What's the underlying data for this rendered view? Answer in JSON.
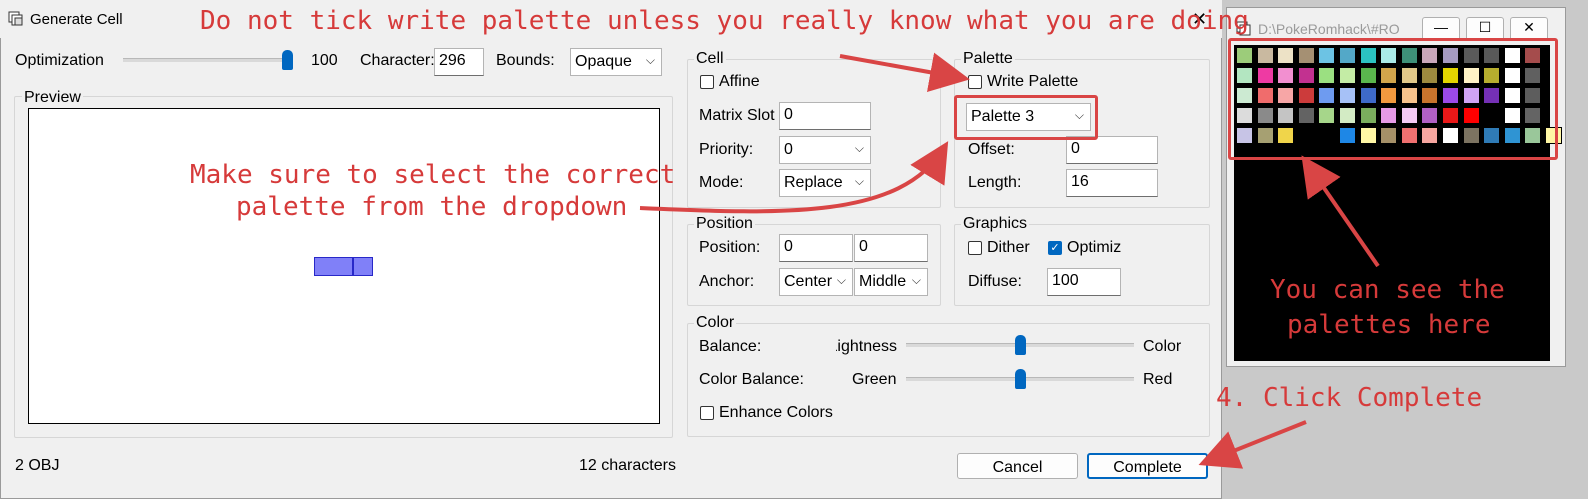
{
  "dialog": {
    "title": "Generate Cell",
    "close_glyph": "✕",
    "optimization_label": "Optimization",
    "optimization_value": "100",
    "optimization_level": 1.0,
    "character_label": "Character:",
    "character_value": "296",
    "bounds_label": "Bounds:",
    "bounds_value": "Opaque",
    "preview_label": "Preview",
    "cell": {
      "group_label": "Cell",
      "affine_label": "Affine",
      "affine_checked": false,
      "matrix_slot_label": "Matrix Slot",
      "matrix_slot_value": "0",
      "priority_label": "Priority:",
      "priority_value": "0",
      "mode_label": "Mode:",
      "mode_value": "Replace"
    },
    "palette": {
      "group_label": "Palette",
      "write_palette_label": "Write Palette",
      "write_palette_checked": false,
      "palette_select_value": "Palette 3",
      "offset_label": "Offset:",
      "offset_value": "0",
      "length_label": "Length:",
      "length_value": "16"
    },
    "position": {
      "group_label": "Position",
      "position_label": "Position:",
      "position_x": "0",
      "position_y": "0",
      "anchor_label": "Anchor:",
      "anchor_h": "Center",
      "anchor_v": "Middle"
    },
    "graphics": {
      "group_label": "Graphics",
      "dither_label": "Dither",
      "dither_checked": false,
      "optimize_label": "Optimize",
      "optimize_checked": true,
      "diffuse_label": "Diffuse:",
      "diffuse_value": "100"
    },
    "color": {
      "group_label": "Color",
      "balance_label": "Balance:",
      "balance_left": "Lightness",
      "balance_right": "Color",
      "balance_level": 0.5,
      "color_balance_label": "Color Balance:",
      "cb_left": "Green",
      "cb_right": "Red",
      "cb_level": 0.5,
      "enhance_label": "Enhance Colors",
      "enhance_checked": false
    },
    "status_left": "2 OBJ",
    "status_mid": "12 characters",
    "cancel_label": "Cancel",
    "complete_label": "Complete"
  },
  "palette_window": {
    "title": "D:\\PokeRomhack\\#RO",
    "minimize_glyph": "—",
    "maximize_glyph": "☐",
    "close_glyph": "✕",
    "rows": [
      [
        "#9ccc7a",
        "#c9b9a0",
        "#ede2c6",
        "#a59073",
        "#6cc3e4",
        "#53a8c8",
        "#2bc3c1",
        "#aaeae7",
        "#3e9078",
        "#c9a7ba",
        "#a59ac1",
        "#5a5a5a",
        "#595959",
        "#ffffff",
        "#a54c4c"
      ],
      [
        "#b3e6c1",
        "#ee3aa3",
        "#f28fd0",
        "#c23190",
        "#9be081",
        "#c4eca5",
        "#5ab64d",
        "#d2a54b",
        "#e1c889",
        "#9d8a3f",
        "#e3d400",
        "#fff3c6",
        "#b7ae2e",
        "#ffffff",
        "#606060"
      ],
      [
        "#ccead2",
        "#f06c6c",
        "#f7a6a6",
        "#cc3b3b",
        "#6e9bf0",
        "#a6c1f7",
        "#3e6ac8",
        "#f2993f",
        "#f7c28c",
        "#c8742d",
        "#9b4ae8",
        "#d0a4f4",
        "#7530b5",
        "#ffffff",
        "#5d5d5d"
      ],
      [
        "#dcdcdc",
        "#8a8a8a",
        "#c4c4c4",
        "#636363",
        "#a6d68a",
        "#d3ebc4",
        "#7bae5d",
        "#e69ae6",
        "#f4caf4",
        "#b160c4",
        "#ea1818",
        "#ff0000",
        "#000000",
        "#ffffff",
        "#646464"
      ],
      [
        "#c7c4e6",
        "#a6a072",
        "#f0d54a",
        "#000000",
        "#000000",
        "#1e87e6",
        "#fff7a5",
        "#a59068",
        "#f07070",
        "#f7a6a0",
        "#ffffff",
        "#7c7361",
        "#2f7bb6",
        "#2f94d3",
        "#9ac79a",
        "#fff7a5"
      ]
    ]
  },
  "annotations": {
    "top": "Do not tick write palette unless you really know what you are doing",
    "middle_line1": "Make sure to select the correct",
    "middle_line2": "palette from the dropdown",
    "right_line1": "You can see the",
    "right_line2": "palettes here",
    "step": "4. Click Complete",
    "color": "#d63a3a"
  }
}
